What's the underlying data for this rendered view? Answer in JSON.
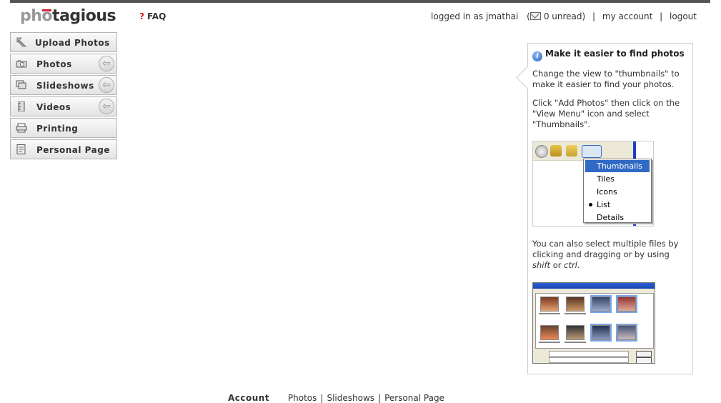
{
  "logo": {
    "part1": "ph",
    "part2": "o",
    "part3": "tagious"
  },
  "faq": {
    "mark": "?",
    "label": "FAQ"
  },
  "user": {
    "logged_in": "logged in as jmathai",
    "unread": "0 unread)",
    "paren_open": "(",
    "my_account": "my account",
    "logout": "logout",
    "sep": "|"
  },
  "nav": {
    "items": [
      {
        "label": "Upload Photos",
        "icon": "upload-icon"
      },
      {
        "label": "Photos",
        "icon": "camera-icon"
      },
      {
        "label": "Slideshows",
        "icon": "slideshow-icon"
      },
      {
        "label": "Videos",
        "icon": "film-icon"
      },
      {
        "label": "Printing",
        "icon": "printer-icon"
      },
      {
        "label": "Personal Page",
        "icon": "page-icon"
      }
    ]
  },
  "help": {
    "title": "Make it easier to find photos",
    "p1": "Change the view to \"thumbnails\" to make it easier to find your photos.",
    "p2": "Click \"Add Photos\" then click on the \"View Menu\" icon and select \"Thumbnails\".",
    "p3_before": "You can also select multiple files by clicking and dragging or by using ",
    "p3_shift": "shift",
    "p3_or": " or ",
    "p3_ctrl": "ctrl",
    "p3_end": ".",
    "menu": [
      "Thumbnails",
      "Tiles",
      "Icons",
      "List",
      "Details"
    ],
    "menu_selected": "Thumbnails",
    "menu_checked": "List"
  },
  "footer": {
    "account": "Account",
    "links": [
      "Photos",
      "Slideshows",
      "Personal Page"
    ],
    "sep": "|"
  },
  "colors": {
    "accent": "#316ac5",
    "topbar": "#555555",
    "logo_mark": "#cc2233"
  }
}
